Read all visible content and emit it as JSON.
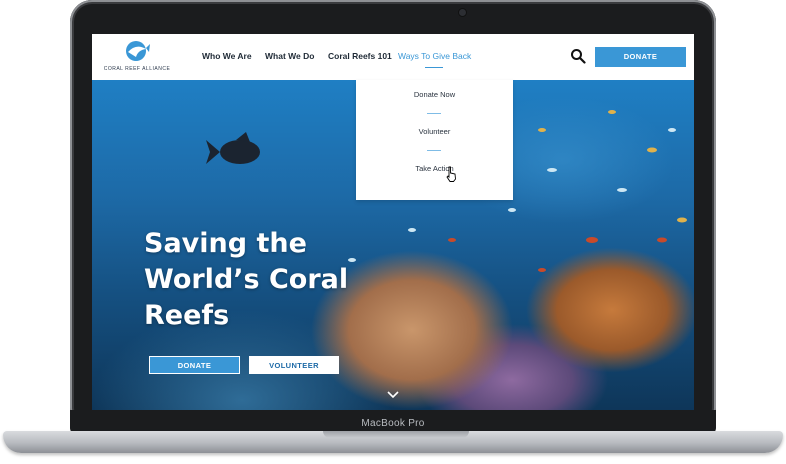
{
  "device": {
    "model_label": "MacBook Pro"
  },
  "site": {
    "logo_text": "CORAL REEF ALLIANCE",
    "nav": [
      {
        "label": "Who We Are"
      },
      {
        "label": "What We Do"
      },
      {
        "label": "Coral Reefs 101"
      },
      {
        "label": "Ways To Give Back",
        "active": true
      }
    ],
    "header_donate_label": "DONATE",
    "dropdown": [
      {
        "label": "Donate Now"
      },
      {
        "label": "Volunteer"
      },
      {
        "label": "Take Action"
      }
    ],
    "hero": {
      "title_lines": [
        "Saving the",
        "World’s Coral",
        "Reefs"
      ],
      "donate_label": "DONATE",
      "volunteer_label": "VOLUNTEER"
    }
  },
  "colors": {
    "accent_blue": "#3a97d6",
    "nav_text": "#1f2a36",
    "laptop_bezel": "#1b1c1e"
  },
  "icons": [
    "logo-fish-icon",
    "search-icon",
    "pointer-cursor-icon",
    "chevron-down-icon"
  ]
}
